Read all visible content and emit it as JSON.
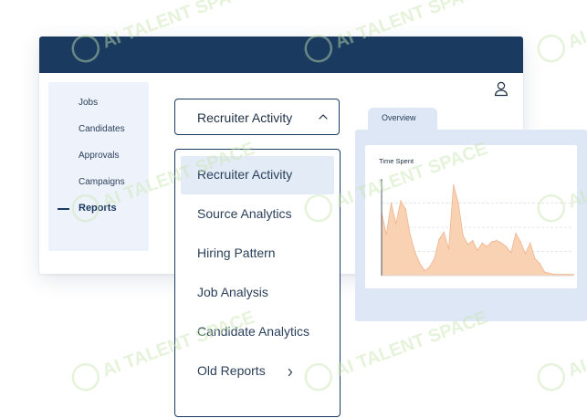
{
  "sidebar": {
    "items": [
      {
        "label": "Jobs"
      },
      {
        "label": "Candidates"
      },
      {
        "label": "Approvals"
      },
      {
        "label": "Campaigns"
      },
      {
        "label": "Reports",
        "active": true
      }
    ]
  },
  "report_select": {
    "value": "Recruiter Activity",
    "expanded": true
  },
  "dropdown": {
    "options": [
      {
        "label": "Recruiter Activity",
        "selected": true
      },
      {
        "label": "Source Analytics"
      },
      {
        "label": "Hiring Pattern"
      },
      {
        "label": "Job Analysis"
      },
      {
        "label": "Candidate Analytics"
      },
      {
        "label": "Old Reports",
        "has_submenu": true
      }
    ]
  },
  "overview": {
    "tab_label": "Overview",
    "chart_title": "Time Spent"
  },
  "chart_data": {
    "type": "area",
    "title": "Time Spent",
    "x": [
      0,
      1,
      2,
      3,
      4,
      5,
      6,
      7,
      8,
      9,
      10,
      11,
      12,
      13,
      14,
      15,
      16,
      17,
      18,
      19,
      20,
      21,
      22,
      23,
      24,
      25,
      26,
      27,
      28,
      29,
      30,
      31,
      32,
      33,
      34,
      35,
      36,
      37,
      38,
      39,
      40
    ],
    "values": [
      52,
      34,
      60,
      43,
      62,
      55,
      33,
      19,
      10,
      4,
      7,
      14,
      30,
      36,
      22,
      75,
      60,
      33,
      26,
      29,
      21,
      27,
      24,
      28,
      29,
      27,
      24,
      19,
      35,
      28,
      18,
      27,
      14,
      10,
      3,
      2,
      1,
      1,
      1,
      1,
      1
    ],
    "ylim": [
      0,
      80
    ],
    "grid": true,
    "colors": {
      "fill": "#f9d2b4",
      "line": "#f0b38d"
    }
  },
  "colors": {
    "navy": "#1b3a60",
    "sidebar_bg": "#eef3fb",
    "panel_bg": "#dde7f5",
    "selected_bg": "#e3ebf7",
    "watermark": "#c9e6b0"
  },
  "icons": {
    "user": "user-icon",
    "select_chevron": "chevron-up-icon",
    "submenu_chevron": "chevron-right-icon"
  },
  "watermark": {
    "text": "AI TALENT SPACE"
  }
}
